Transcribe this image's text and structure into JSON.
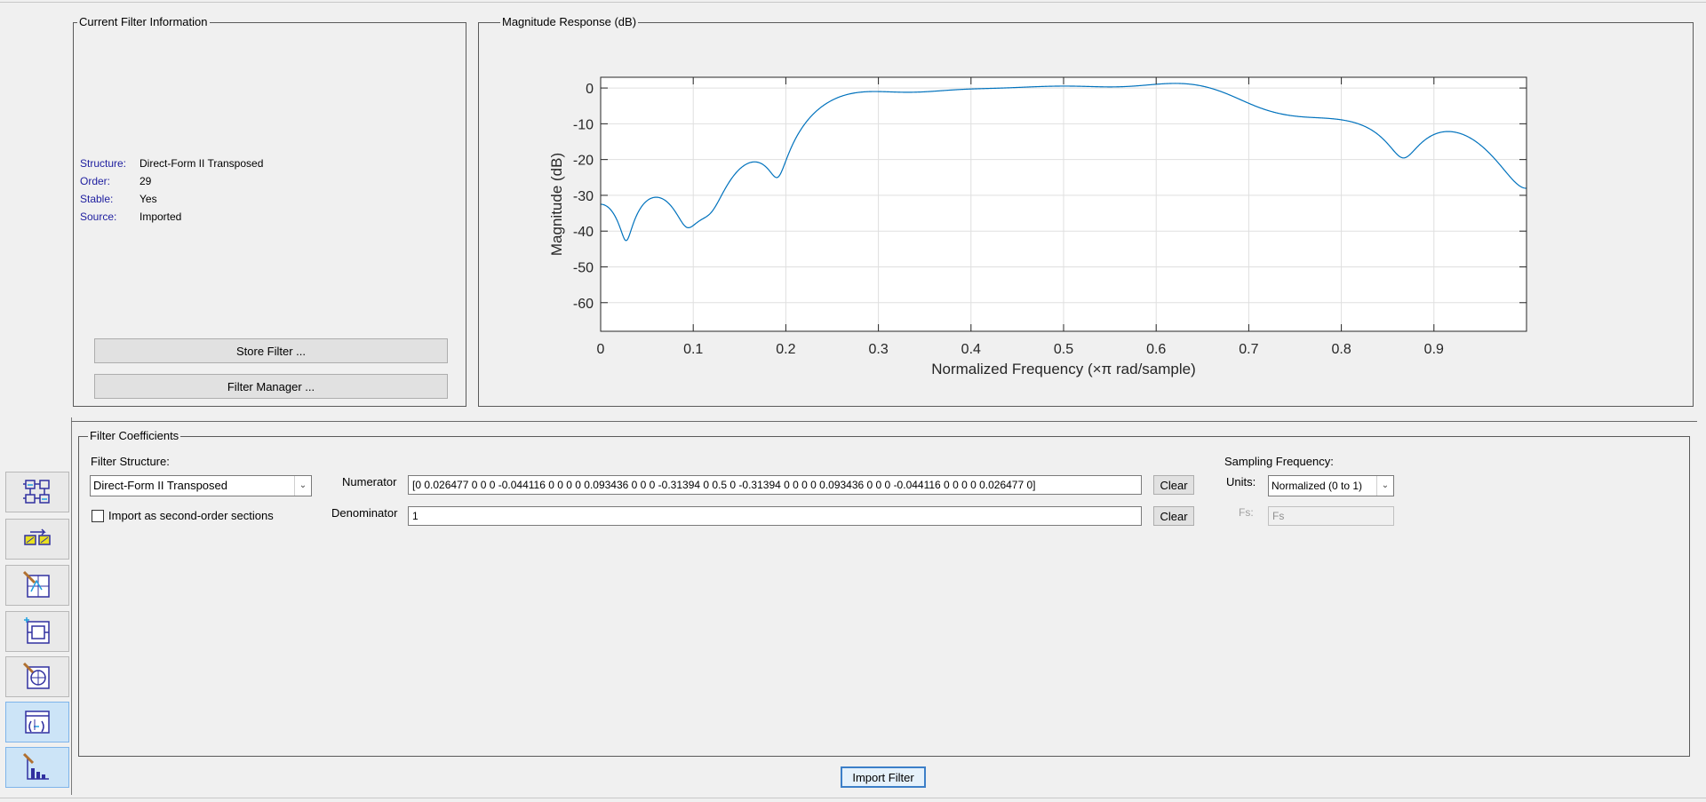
{
  "current_filter_info": {
    "title": "Current Filter Information",
    "rows": [
      {
        "label": "Structure:",
        "value": "Direct-Form II Transposed"
      },
      {
        "label": "Order:",
        "value": "29"
      },
      {
        "label": "Stable:",
        "value": "Yes"
      },
      {
        "label": "Source:",
        "value": "Imported"
      }
    ],
    "store_button": "Store Filter ...",
    "manager_button": "Filter Manager ..."
  },
  "magnitude_panel": {
    "title": "Magnitude Response (dB)"
  },
  "chart_data": {
    "type": "line",
    "xlabel": "Normalized Frequency (×π rad/sample)",
    "ylabel": "Magnitude (dB)",
    "xlim": [
      0,
      1
    ],
    "ylim": [
      -68,
      3
    ],
    "xticks": [
      "0",
      "0.1",
      "0.2",
      "0.3",
      "0.4",
      "0.5",
      "0.6",
      "0.7",
      "0.8",
      "0.9"
    ],
    "xtick_values": [
      0,
      0.1,
      0.2,
      0.3,
      0.4,
      0.5,
      0.6,
      0.7,
      0.8,
      0.9
    ],
    "yticks": [
      "0",
      "-10",
      "-20",
      "-30",
      "-40",
      "-50",
      "-60"
    ],
    "ytick_values": [
      0,
      -10,
      -20,
      -30,
      -40,
      -50,
      -60
    ],
    "grid": true,
    "line_color": "#0072bd",
    "numerator": [
      0,
      0.026477,
      0,
      0,
      0,
      -0.044116,
      0,
      0,
      0,
      0,
      0.093436,
      0,
      0,
      0,
      -0.31394,
      0,
      0.5,
      0,
      -0.31394,
      0,
      0,
      0,
      0,
      0.093436,
      0,
      0,
      0,
      -0.044116,
      0,
      0,
      0,
      0,
      0.026477,
      0
    ]
  },
  "filter_coefficients": {
    "title": "Filter Coefficients",
    "structure_label": "Filter Structure:",
    "structure_value": "Direct-Form II Transposed",
    "sos_checkbox_label": "Import as second-order sections",
    "numerator_label": "Numerator",
    "numerator_value": "[0 0.026477 0 0 0 -0.044116 0 0 0 0 0.093436 0 0 0 -0.31394 0 0.5 0 -0.31394 0 0 0 0 0.093436 0 0 0 -0.044116 0 0 0 0 0.026477 0]",
    "denominator_label": "Denominator",
    "denominator_value": "1",
    "clear_label": "Clear",
    "sampling_label": "Sampling Frequency:",
    "units_label": "Units:",
    "units_value": "Normalized (0 to 1)",
    "fs_label": "Fs:",
    "fs_value": "Fs"
  },
  "import_button": "Import Filter",
  "sidebar": {
    "items": [
      {
        "icon": "design-filter-icon",
        "active": false
      },
      {
        "icon": "transform-filter-icon",
        "active": false
      },
      {
        "icon": "pole-zero-editor-icon",
        "active": false
      },
      {
        "icon": "realize-model-icon",
        "active": false
      },
      {
        "icon": "multirate-design-icon",
        "active": false
      },
      {
        "icon": "import-filter-icon",
        "active": true
      },
      {
        "icon": "export-filter-icon",
        "active": true
      }
    ]
  },
  "colors": {
    "background": "#f0f0f0",
    "accent": "#0072bd",
    "label_blue": "#2020a0"
  }
}
